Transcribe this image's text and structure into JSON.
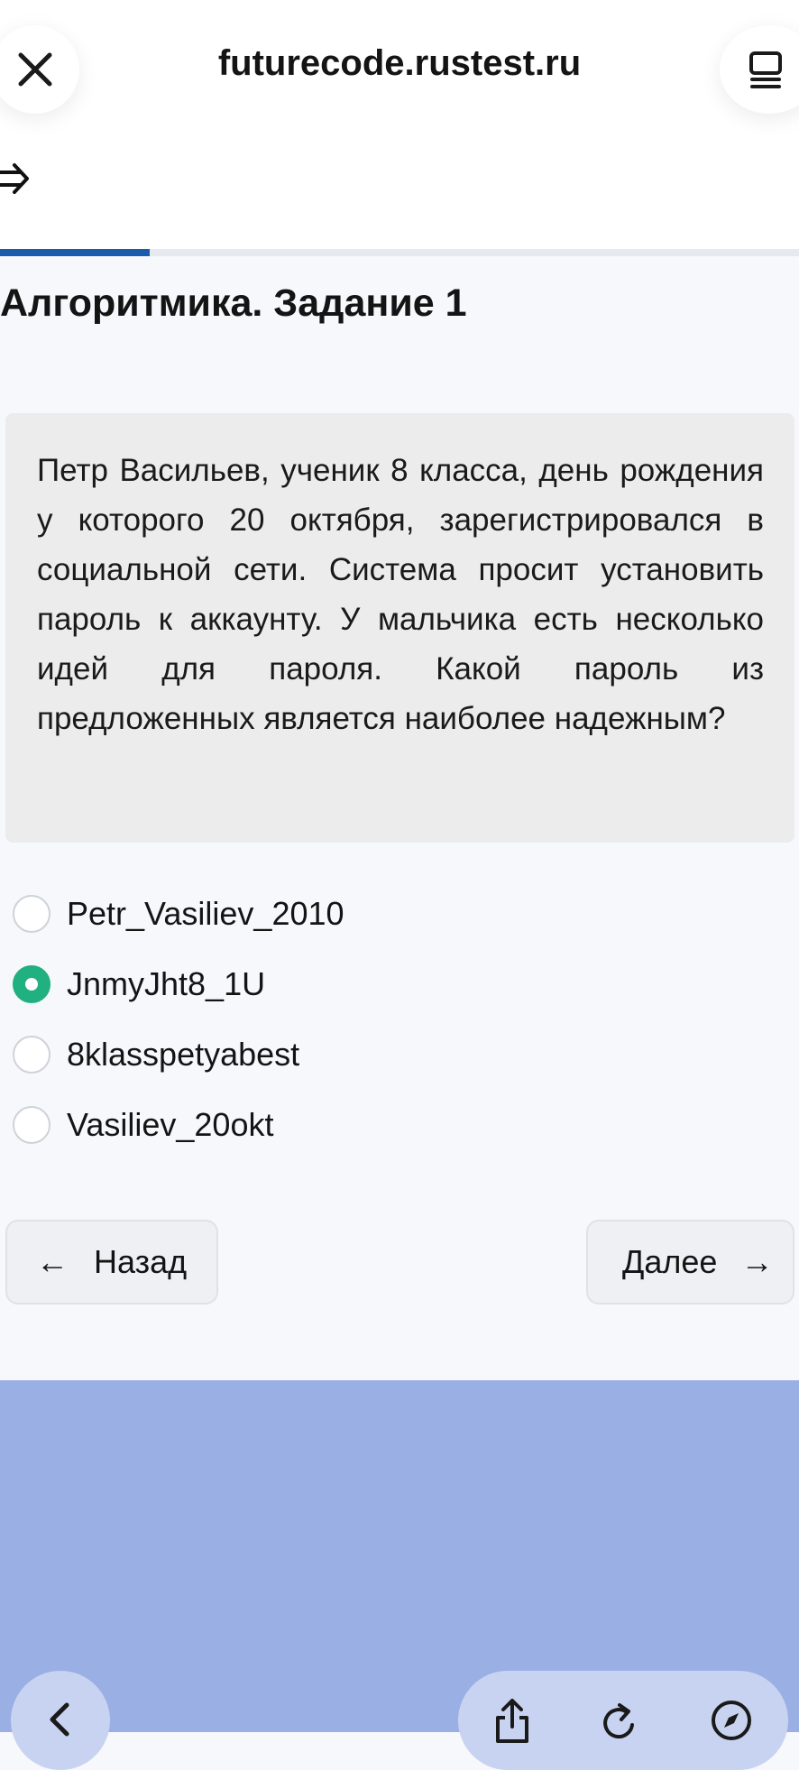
{
  "browser": {
    "url": "futurecode.rustest.ru"
  },
  "progress": {
    "fraction": 0.187
  },
  "page": {
    "title": "Алгоритмика. Задание 1"
  },
  "question": {
    "text": "Петр Васильев, ученик 8 класса, день рождения у которого 20 октября, зарегистрировался в социальной сети. Система просит установить пароль к аккаунту. У мальчика есть несколько идей для пароля. Какой пароль из предложенных является наиболее надежным?"
  },
  "options": [
    {
      "label": "Petr_Vasiliev_2010",
      "selected": false
    },
    {
      "label": "JnmyJht8_1U",
      "selected": true
    },
    {
      "label": "8klasspetyabest",
      "selected": false
    },
    {
      "label": "Vasiliev_20okt",
      "selected": false
    }
  ],
  "nav": {
    "back_label": "Назад",
    "back_arrow": "←",
    "next_label": "Далее",
    "next_arrow": "→"
  },
  "colors": {
    "progress": "#1b5bad",
    "selected": "#21b07f",
    "footer": "#9aafe3"
  },
  "icons": [
    "close-icon",
    "tabs-icon",
    "exit-icon",
    "back-arrow-icon",
    "forward-arrow-icon",
    "chevron-left-icon",
    "share-icon",
    "reload-icon",
    "compass-icon"
  ]
}
